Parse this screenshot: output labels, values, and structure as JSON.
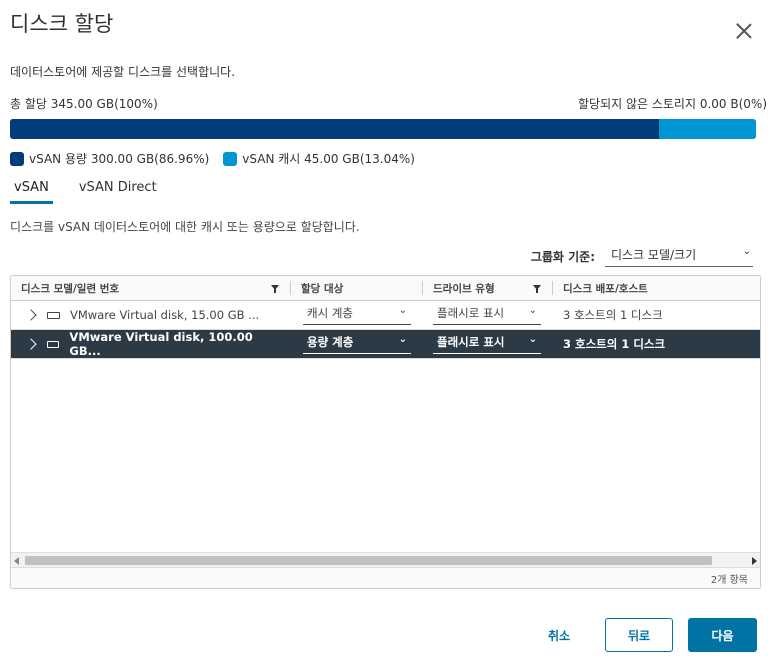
{
  "dialog": {
    "title": "디스크 할당",
    "subtitle": "데이터스토어에 제공할 디스크를 선택합니다."
  },
  "allocation": {
    "total_label": "총 할당 345.00 GB(100%)",
    "unallocated_label": "할당되지 않은 스토리지 0.00 B(0%)",
    "capacity_fraction": 0.8696,
    "cache_fraction": 0.1304,
    "capacity_color": "#003d79",
    "cache_color": "#0095d3",
    "legend": [
      {
        "label": "vSAN 용량 300.00 GB(86.96%)",
        "color": "#003d79"
      },
      {
        "label": "vSAN 캐시 45.00 GB(13.04%)",
        "color": "#0095d3"
      }
    ]
  },
  "tabs": [
    {
      "label": "vSAN",
      "active": true
    },
    {
      "label": "vSAN Direct",
      "active": false
    }
  ],
  "description": "디스크를 vSAN 데이터스토어에 대한 캐시 또는 용량으로 할당합니다.",
  "group_by": {
    "label": "그룹화 기준:",
    "value": "디스크 모델/크기"
  },
  "grid": {
    "columns": [
      "디스크 모델/일련 번호",
      "할당 대상",
      "드라이브 유형",
      "디스크 배포/호스트"
    ],
    "rows": [
      {
        "model": "VMware Virtual disk, 15.00 GB ...",
        "claim": "캐시 계층",
        "drive_type": "플래시로 표시",
        "distribution": "3 호스트의 1 디스크",
        "selected": false
      },
      {
        "model": "VMware Virtual disk, 100.00 GB...",
        "claim": "용량 계층",
        "drive_type": "플래시로 표시",
        "distribution": "3 호스트의 1 디스크",
        "selected": true
      }
    ],
    "footer": "2개 항목"
  },
  "buttons": {
    "cancel": "취소",
    "back": "뒤로",
    "next": "다음"
  },
  "icons": {
    "close": "close-icon",
    "expand": "chevron-right-icon",
    "disk": "disk-icon",
    "filter": "filter-icon",
    "dropdown": "chevron-down-icon"
  }
}
